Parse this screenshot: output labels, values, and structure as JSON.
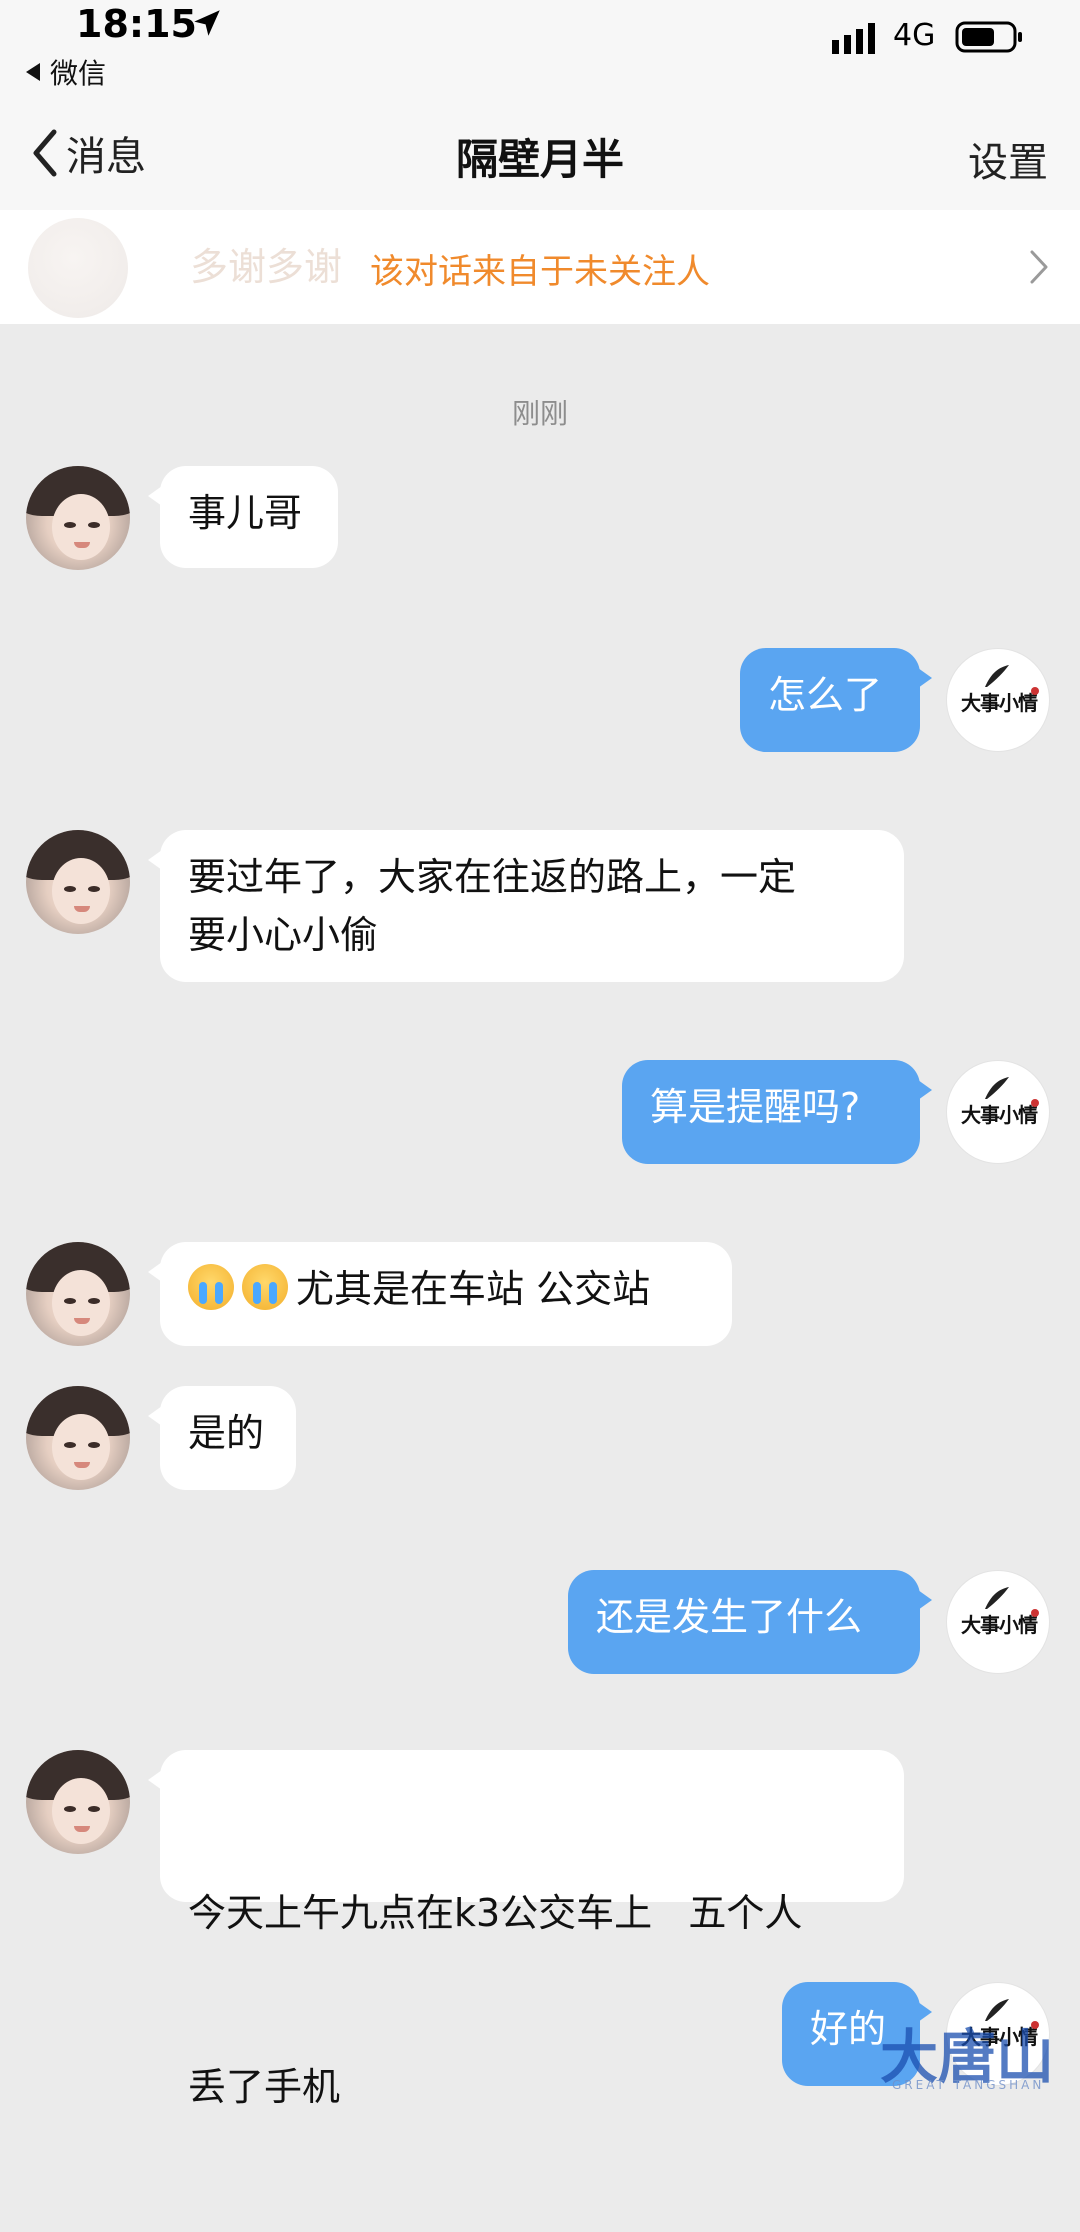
{
  "status_bar": {
    "time": "18:15",
    "back_app": "微信",
    "network": "4G"
  },
  "nav": {
    "back_label": "消息",
    "title": "隔壁月半",
    "settings_label": "设置"
  },
  "banner": {
    "ghost_text": "多谢多谢",
    "text": "该对话来自于未关注人"
  },
  "timestamp": "刚刚",
  "brand_avatar_text": "大事小情",
  "messages": [
    {
      "side": "left",
      "text": "事儿哥"
    },
    {
      "side": "right",
      "text": "怎么了"
    },
    {
      "side": "left",
      "line1": "要过年了，大家在往返的路上，一定",
      "line2": "要小心小偷"
    },
    {
      "side": "right",
      "text": "算是提醒吗?"
    },
    {
      "side": "left",
      "text": "尤其是在车站  公交站",
      "emoji": [
        "crying-emoji",
        "crying-emoji"
      ]
    },
    {
      "side": "left",
      "text": "是的"
    },
    {
      "side": "right",
      "text": "还是发生了什么"
    },
    {
      "side": "left",
      "line1": "今天上午九点在k3公交车上   五个人",
      "line2": "丢了手机"
    },
    {
      "side": "right",
      "text": "好的"
    }
  ],
  "watermark": {
    "text": "大唐山",
    "sub": "GREAT TANGSHAN"
  },
  "colors": {
    "outgoing_bubble": "#5aa5f1",
    "incoming_bubble": "#ffffff",
    "banner_text": "#f08a2c",
    "background": "#ebebeb"
  }
}
